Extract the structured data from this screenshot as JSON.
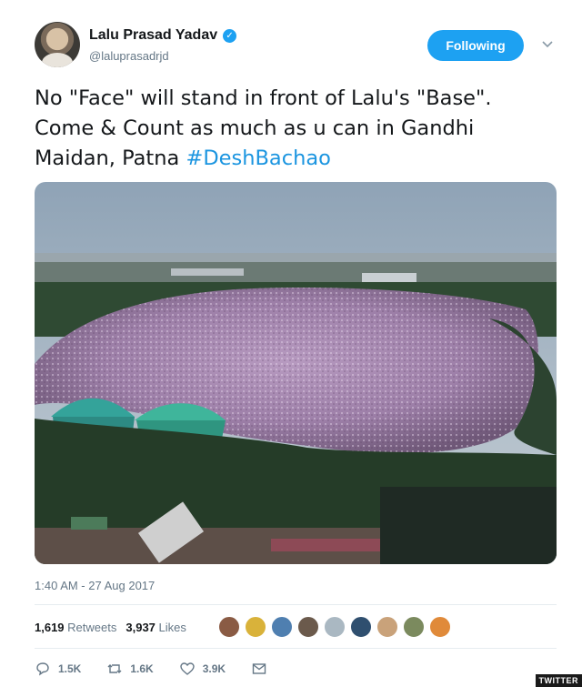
{
  "author": {
    "name": "Lalu Prasad Yadav",
    "handle": "@laluprasadrjd",
    "verified_icon": "verified-badge-icon"
  },
  "follow_button": {
    "label": "Following"
  },
  "tweet": {
    "text": "No \"Face\" will stand in front of Lalu's \"Base\". Come & Count as much as u can in Gandhi Maidan, Patna ",
    "hashtag": "#DeshBachao"
  },
  "timestamp": "1:40 AM - 27 Aug 2017",
  "stats": {
    "retweets_count": "1,619",
    "retweets_label": "Retweets",
    "likes_count": "3,937",
    "likes_label": "Likes"
  },
  "actions": {
    "reply_count": "1.5K",
    "retweet_count": "1.6K",
    "like_count": "3.9K"
  },
  "colors": {
    "accent": "#1da1f2",
    "hashtag": "#1b95e0",
    "muted": "#657786"
  },
  "watermark": "TWITTER"
}
